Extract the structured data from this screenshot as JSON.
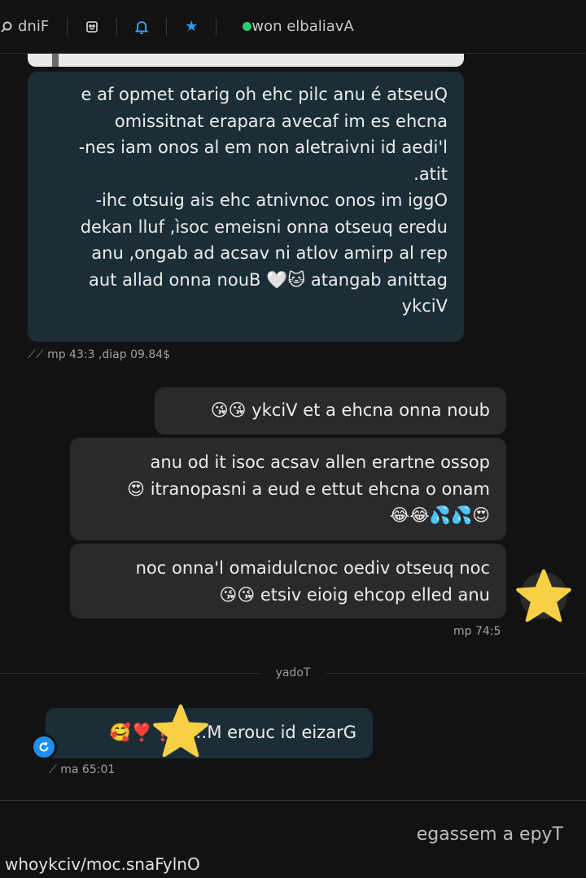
{
  "header": {
    "status_label": "Available now",
    "status_color": "#2ecc71",
    "find_label": "Find",
    "icons": [
      "star-icon",
      "bell-icon",
      "media-icon",
      "search-icon"
    ]
  },
  "messages": {
    "incoming_1": {
      "lines": [
        "Questa é una clip che ho girato tempo fa e",
        "anche se mi faceva arapare tantissimo",
        "l'idea di inviartela non me la sono mai sen-",
        "tita.",
        "Oggi mi sono convinta che sia giusto chi-",
        "udere questo anno insieme così, full naked",
        "per la prima volta in vasca da bagno, una",
        "gattina bagnata 🐱🤍 Buon anno dalla tua",
        "Vicky"
      ],
      "meta": "$48.90 paid, 3:34 pm"
    },
    "outgoing_1": {
      "text": "buon anno anche a te Vicky 😘😘"
    },
    "outgoing_2": {
      "lines": [
        "posso entrare nella vasca cosi ti do una",
        "mano o anche tutte e due a insaponarti 😍",
        "😍💦💦😂😂"
      ]
    },
    "outgoing_3": {
      "lines": [
        "con questo video concludiamo l'anno con",
        "una delle poche gioie viste 😘😘"
      ],
      "meta": "5:47 pm"
    },
    "divider": "Today",
    "incoming_2": {
      "text": "Grazie di cuore M…n ❗❣️🥰",
      "meta": "10:56 am"
    }
  },
  "composer": {
    "placeholder": "Type a message"
  },
  "watermark": "OnlyFans.com/vickyohw",
  "colors": {
    "accent": "#2a9df4",
    "star": "#f7d046"
  }
}
